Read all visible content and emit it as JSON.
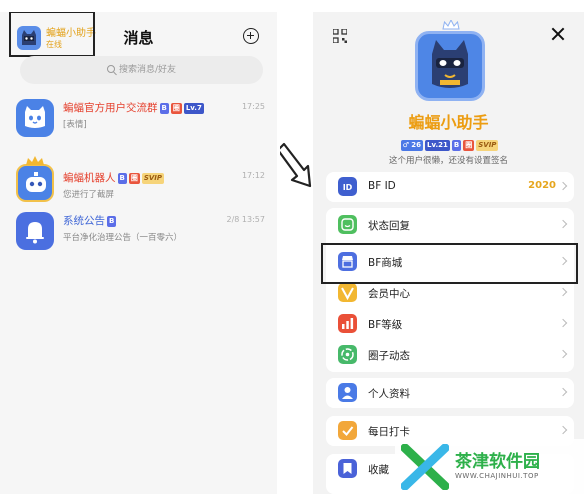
{
  "left": {
    "me": {
      "name": "蝙蝠小助手",
      "status": "在线"
    },
    "title": "消息",
    "search_placeholder": "搜索消息/好友",
    "chats": [
      {
        "name": "蝙蝠官方用户交流群",
        "badges": [
          "B",
          "圈",
          "Lv.7"
        ],
        "preview": "[表情]",
        "time": "17:25"
      },
      {
        "name": "蝙蝠机器人",
        "badges": [
          "B",
          "圈",
          "SVIP"
        ],
        "preview": "您进行了截屏",
        "time": "17:12"
      },
      {
        "name": "系统公告",
        "badges": [
          "B"
        ],
        "preview": "平台净化治理公告（一百零六）",
        "time": "2/8 13:57"
      }
    ]
  },
  "right": {
    "profile_name": "蝙蝠小助手",
    "badges": [
      "♂ 26",
      "Lv.21",
      "B",
      "圈",
      "SVIP"
    ],
    "signature": "这个用户很懒，还没有设置签名",
    "bf_id": {
      "label": "BF ID",
      "value": "2020"
    },
    "menu": [
      {
        "label": "状态回复",
        "color": "#4fbf5f"
      },
      {
        "label": "BF商城",
        "color": "#4e6fe0"
      },
      {
        "label": "会员中心",
        "color": "#f2b731"
      },
      {
        "label": "BF等级",
        "color": "#ea5038"
      },
      {
        "label": "圈子动态",
        "color": "#47b96a"
      },
      {
        "label": "个人资料",
        "color": "#4a7ae6"
      },
      {
        "label": "每日打卡",
        "color": "#f2a73a"
      },
      {
        "label": "收藏",
        "color": "#4a62d8"
      }
    ]
  },
  "watermark": {
    "text": "茶津软件园",
    "url": "WWW.CHAJINHUI.TOP"
  },
  "colors": {
    "accent_orange": "#e3a21a",
    "red_name": "#e5412e",
    "blue_name": "#3f66d6",
    "brand_green": "#2db04a"
  }
}
